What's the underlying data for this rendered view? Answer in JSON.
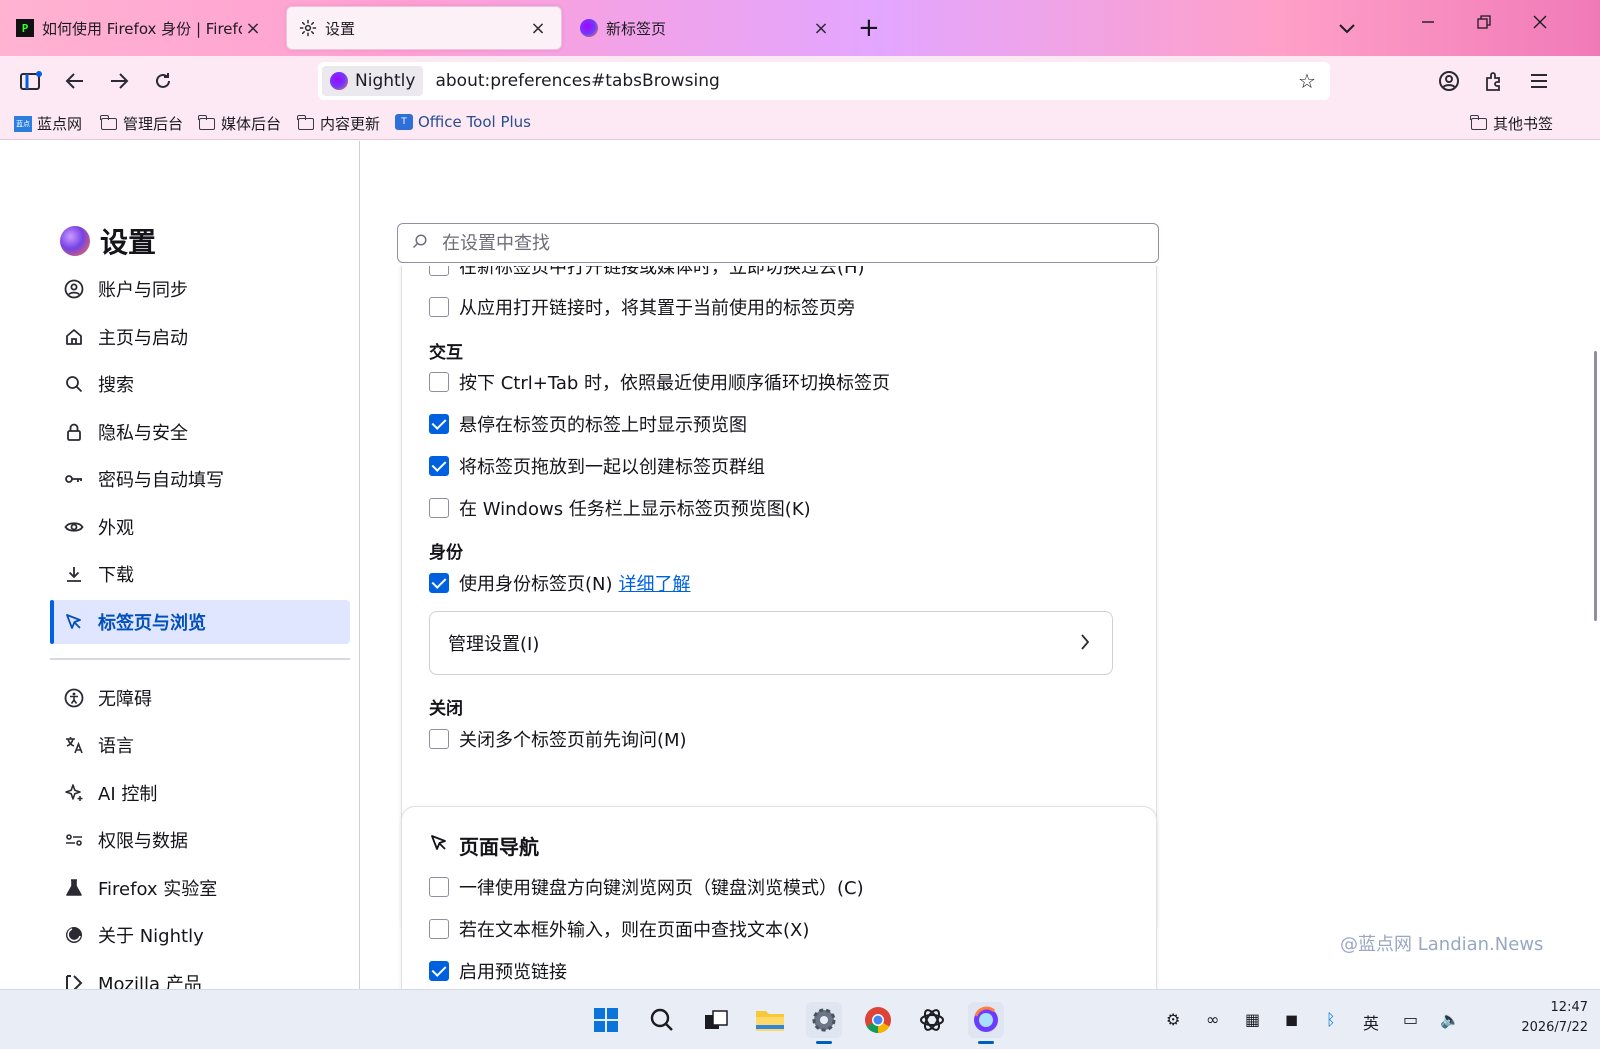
{
  "tabs": [
    {
      "title": "如何使用 Firefox 身份 | Firefox 帮助",
      "icon": "pycharm-icon"
    },
    {
      "title": "设置",
      "icon": "gear-icon"
    },
    {
      "title": "新标签页",
      "icon": "firefox-icon"
    }
  ],
  "urlbar": {
    "identity_label": "Nightly",
    "url": "about:preferences#tabsBrowsing"
  },
  "bookmarks": [
    {
      "label": "蓝点网",
      "icon": "landian-icon"
    },
    {
      "label": "管理后台",
      "icon": "folder-icon"
    },
    {
      "label": "媒体后台",
      "icon": "folder-icon"
    },
    {
      "label": "内容更新",
      "icon": "folder-icon"
    },
    {
      "label": "Office Tool Plus",
      "icon": "office-tool-plus-icon"
    },
    {
      "label": "其他书签",
      "icon": "folder-icon"
    }
  ],
  "sidebar": {
    "title": "设置",
    "items": [
      {
        "label": "账户与同步",
        "icon": "account-icon"
      },
      {
        "label": "主页与启动",
        "icon": "home-icon"
      },
      {
        "label": "搜索",
        "icon": "search-icon"
      },
      {
        "label": "隐私与安全",
        "icon": "lock-icon"
      },
      {
        "label": "密码与自动填写",
        "icon": "key-icon"
      },
      {
        "label": "外观",
        "icon": "eye-icon"
      },
      {
        "label": "下载",
        "icon": "download-icon"
      },
      {
        "label": "标签页与浏览",
        "icon": "cursor-icon",
        "selected": true
      }
    ],
    "items2": [
      {
        "label": "无障碍",
        "icon": "accessibility-icon"
      },
      {
        "label": "语言",
        "icon": "translate-icon"
      },
      {
        "label": "AI 控制",
        "icon": "sparkle-icon"
      },
      {
        "label": "权限与数据",
        "icon": "sliders-icon"
      },
      {
        "label": "Firefox 实验室",
        "icon": "flask-icon"
      },
      {
        "label": "关于 Nightly",
        "icon": "nightly-icon"
      },
      {
        "label": "Mozilla 产品",
        "icon": "mozilla-icon"
      }
    ]
  },
  "search": {
    "placeholder": "在设置中查找"
  },
  "tabs_section": {
    "partial_option": "在新标签页中打开链接或媒体时，立即切换过去(H)",
    "option_from_app": "从应用打开链接时，将其置于当前使用的标签页旁",
    "interaction_heading": "交互",
    "ctrl_tab": "按下 Ctrl+Tab 时，依照最近使用顺序循环切换标签页",
    "hover_preview": "悬停在标签页的标签上时显示预览图",
    "drag_group": "将标签页拖放到一起以创建标签页群组",
    "taskbar_preview": "在 Windows 任务栏上显示标签页预览图(K)",
    "identity_heading": "身份",
    "use_identity_tabs": "使用身份标签页(N)",
    "learn_more": "详细了解",
    "manage_settings": "管理设置(I)",
    "close_heading": "关闭",
    "confirm_close_multiple": "关闭多个标签页前先询问(M)"
  },
  "page_nav_section": {
    "heading": "页面导航",
    "caret_browsing": "一律使用键盘方向键浏览网页（键盘浏览模式）(C)",
    "find_as_you_type": "若在文本框外输入，则在页面中查找文本(X)",
    "preload_links": "启用预览链接"
  },
  "watermark": "@蓝点网 Landian.News",
  "taskbar": {
    "tray_lang": "英",
    "time": "12:47",
    "date": "2026/7/22"
  },
  "colors": {
    "accent": "#0061e0",
    "selected_bg": "#e0e6ff",
    "tab_gradient_start": "#ffb3d1",
    "tab_gradient_end": "#f07ab8"
  }
}
